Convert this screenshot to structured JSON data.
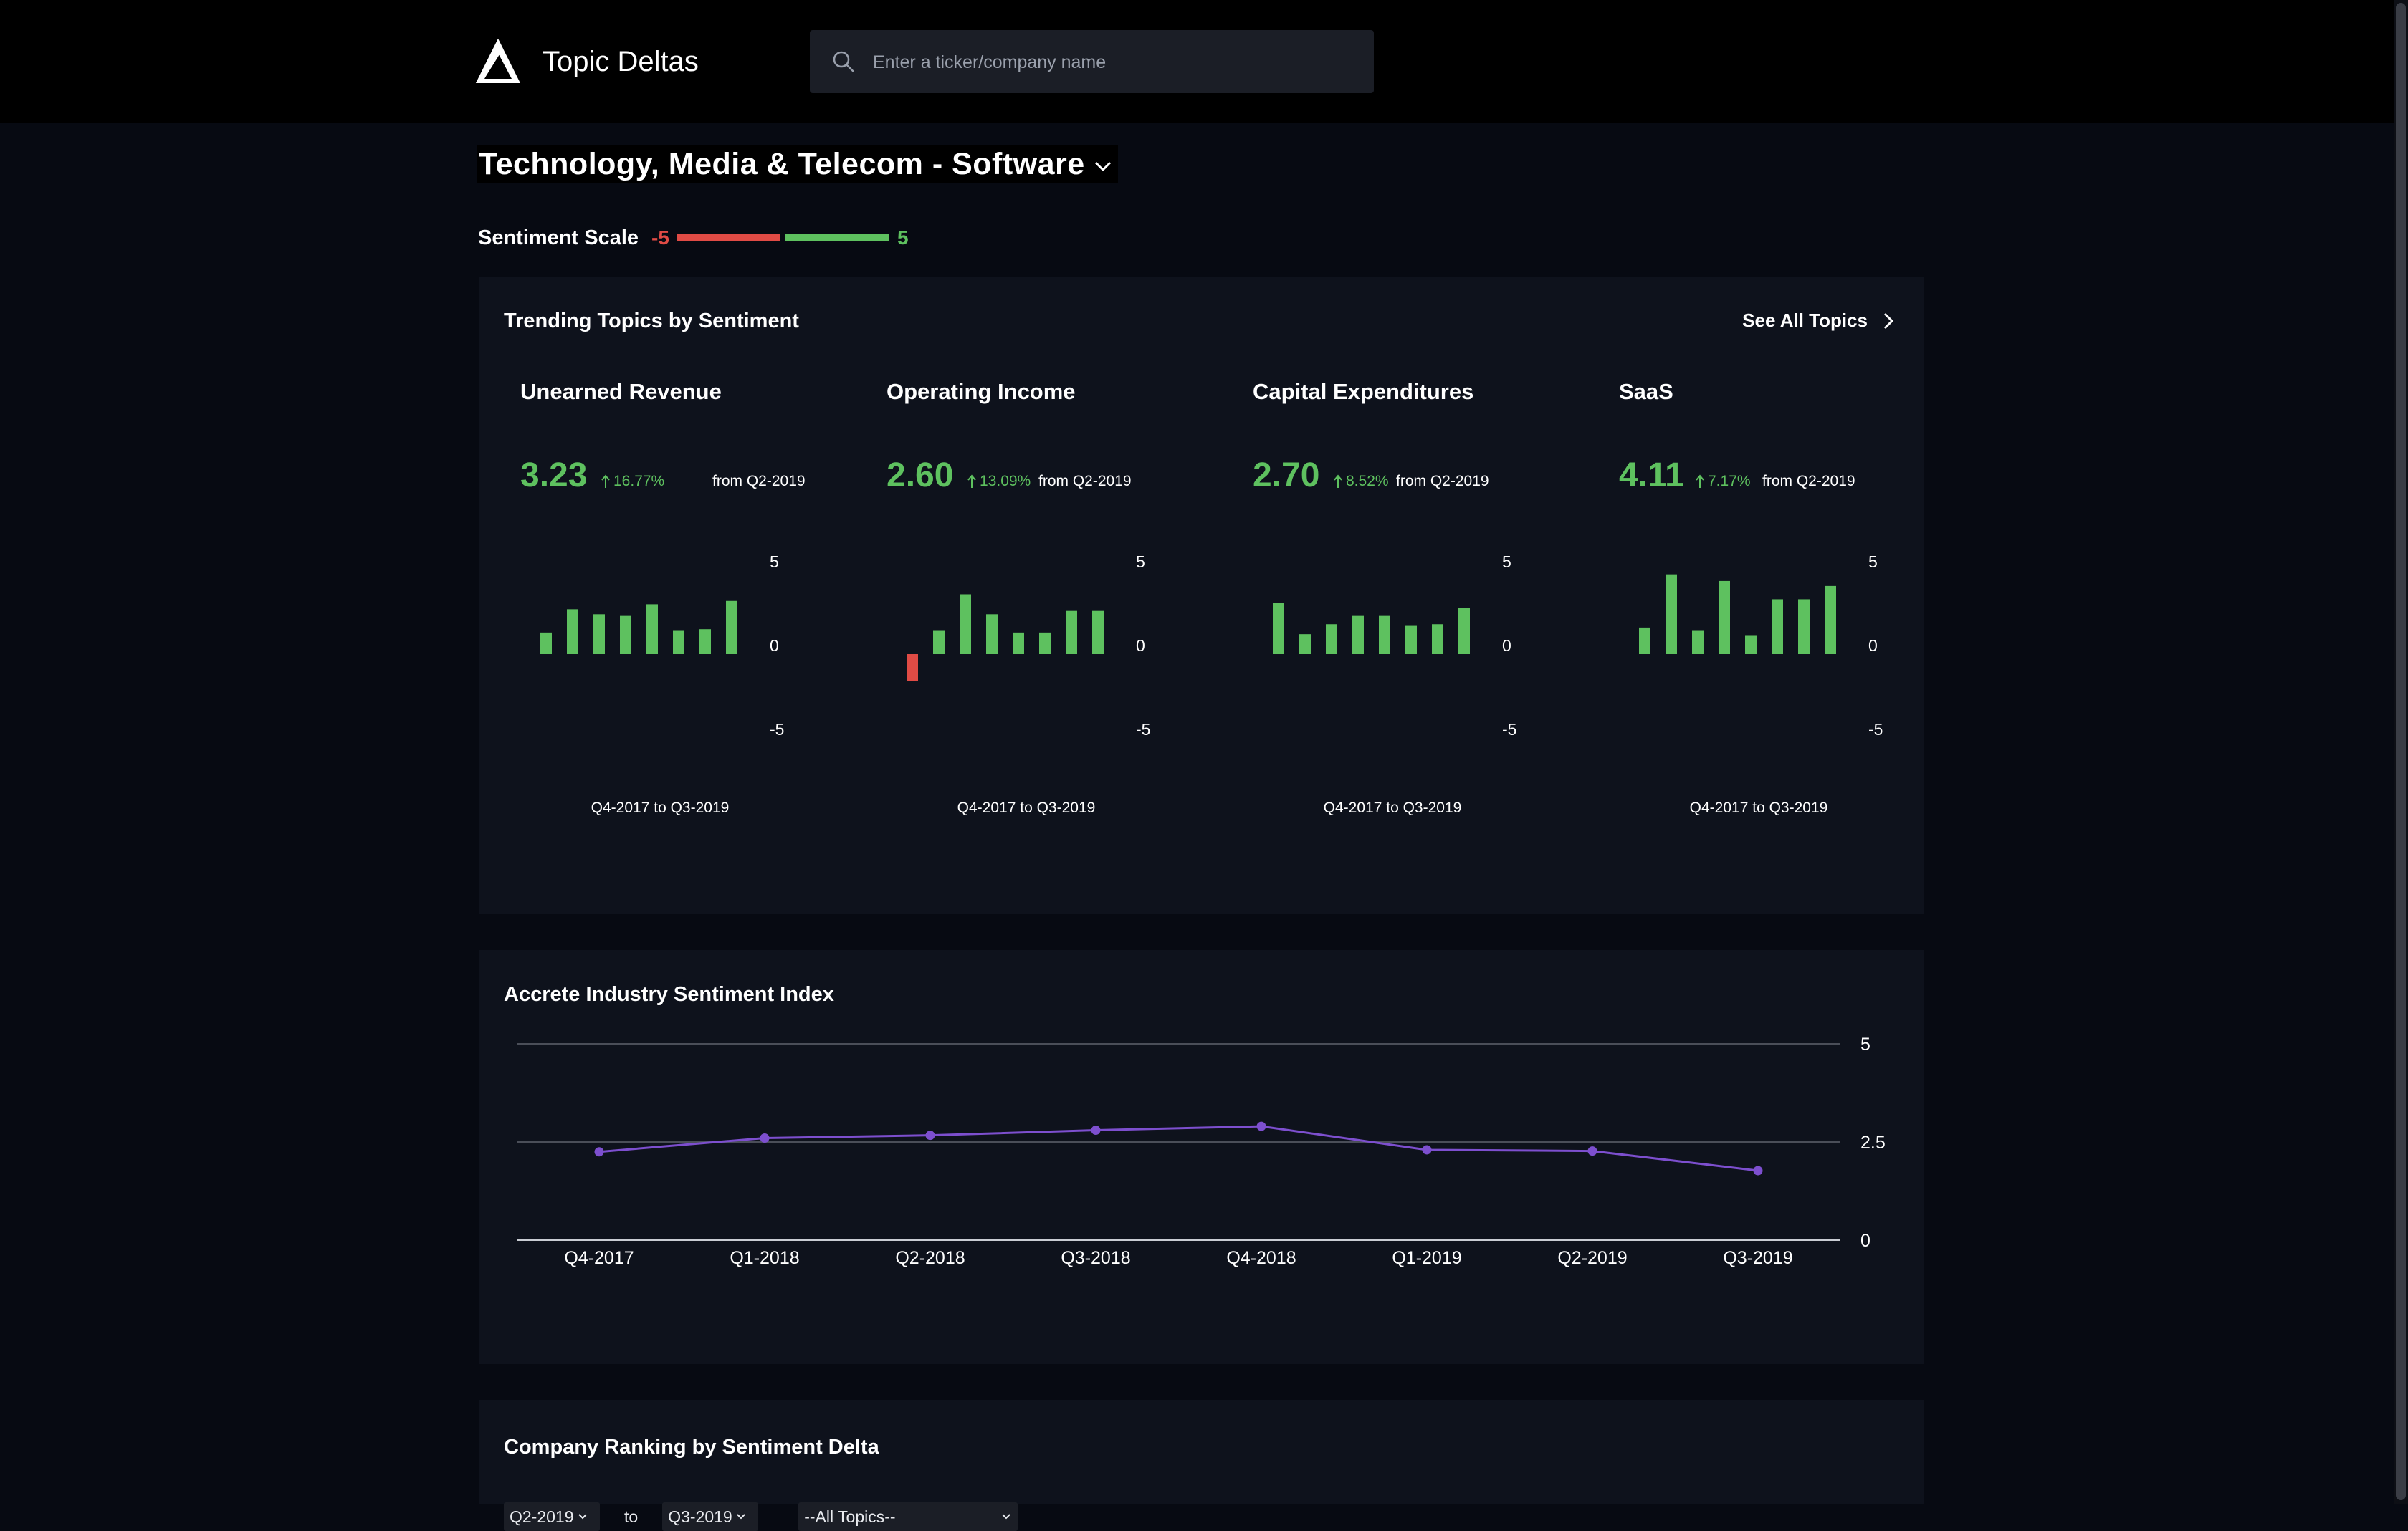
{
  "header": {
    "app_title": "Topic Deltas",
    "search_placeholder": "Enter a ticker/company name"
  },
  "page": {
    "industry_title": "Technology, Media & Telecom - Software"
  },
  "sentiment_scale": {
    "label": "Sentiment Scale",
    "min": "-5",
    "max": "5",
    "negative_color": "#e04b45",
    "positive_color": "#5ec15f"
  },
  "trending": {
    "title": "Trending Topics by Sentiment",
    "see_all_label": "See All Topics",
    "topics": [
      {
        "name": "Unearned Revenue",
        "score": "3.23",
        "delta": "16.77%",
        "from": "from Q2-2019",
        "axis_labels": [
          "5",
          "0",
          "-5"
        ],
        "range": "Q4-2017 to Q3-2019",
        "values": [
          1.3,
          2.7,
          2.4,
          2.3,
          3.0,
          1.4,
          1.5,
          3.2
        ]
      },
      {
        "name": "Operating Income",
        "score": "2.60",
        "delta": "13.09%",
        "from": "from Q2-2019",
        "axis_labels": [
          "5",
          "0",
          "-5"
        ],
        "range": "Q4-2017 to Q3-2019",
        "values": [
          -1.6,
          1.4,
          3.6,
          2.4,
          1.3,
          1.3,
          2.6,
          2.6
        ]
      },
      {
        "name": "Capital Expenditures",
        "score": "2.70",
        "delta": "8.52%",
        "from": "from Q2-2019",
        "axis_labels": [
          "5",
          "0",
          "-5"
        ],
        "range": "Q4-2017 to Q3-2019",
        "values": [
          3.1,
          1.2,
          1.8,
          2.3,
          2.3,
          1.7,
          1.8,
          2.8
        ]
      },
      {
        "name": "SaaS",
        "score": "4.11",
        "delta": "7.17%",
        "from": "from Q2-2019",
        "axis_labels": [
          "5",
          "0",
          "-5"
        ],
        "range": "Q4-2017 to Q3-2019",
        "values": [
          1.6,
          4.8,
          1.4,
          4.4,
          1.1,
          3.3,
          3.3,
          4.1
        ]
      }
    ]
  },
  "index_chart": {
    "title": "Accrete Industry Sentiment Index"
  },
  "chart_data": {
    "type": "line",
    "title": "Accrete Industry Sentiment Index",
    "categories": [
      "Q4-2017",
      "Q1-2018",
      "Q2-2018",
      "Q3-2018",
      "Q4-2018",
      "Q1-2019",
      "Q2-2019",
      "Q3-2019"
    ],
    "series": [
      {
        "values": [
          2.25,
          2.6,
          2.67,
          2.8,
          2.9,
          2.3,
          2.27,
          1.77
        ],
        "color": "#7d4fcf"
      }
    ],
    "yticks": [
      "5",
      "2.5",
      "0"
    ],
    "ylim": [
      0,
      5
    ],
    "grid": true
  },
  "ranking": {
    "title": "Company Ranking by Sentiment Delta",
    "from_value": "Q2-2019",
    "to_label": "to",
    "to_value": "Q3-2019",
    "topic_value": "--All Topics--"
  }
}
